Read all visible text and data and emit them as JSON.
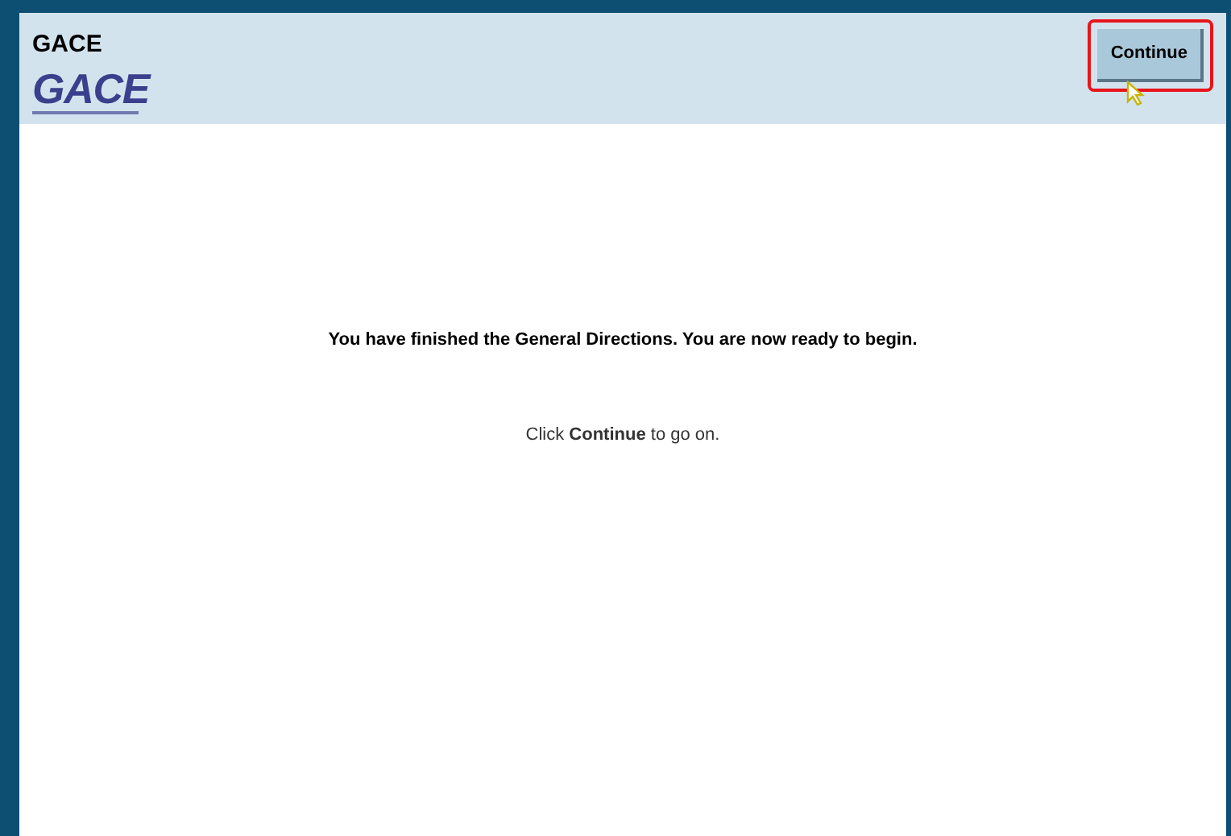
{
  "header": {
    "title": "GACE",
    "logo": "GACE",
    "continue_button": "Continue"
  },
  "message": "You have finished the General Directions. You are now ready to begin.",
  "instruction": "Click **Continue** to go on."
}
